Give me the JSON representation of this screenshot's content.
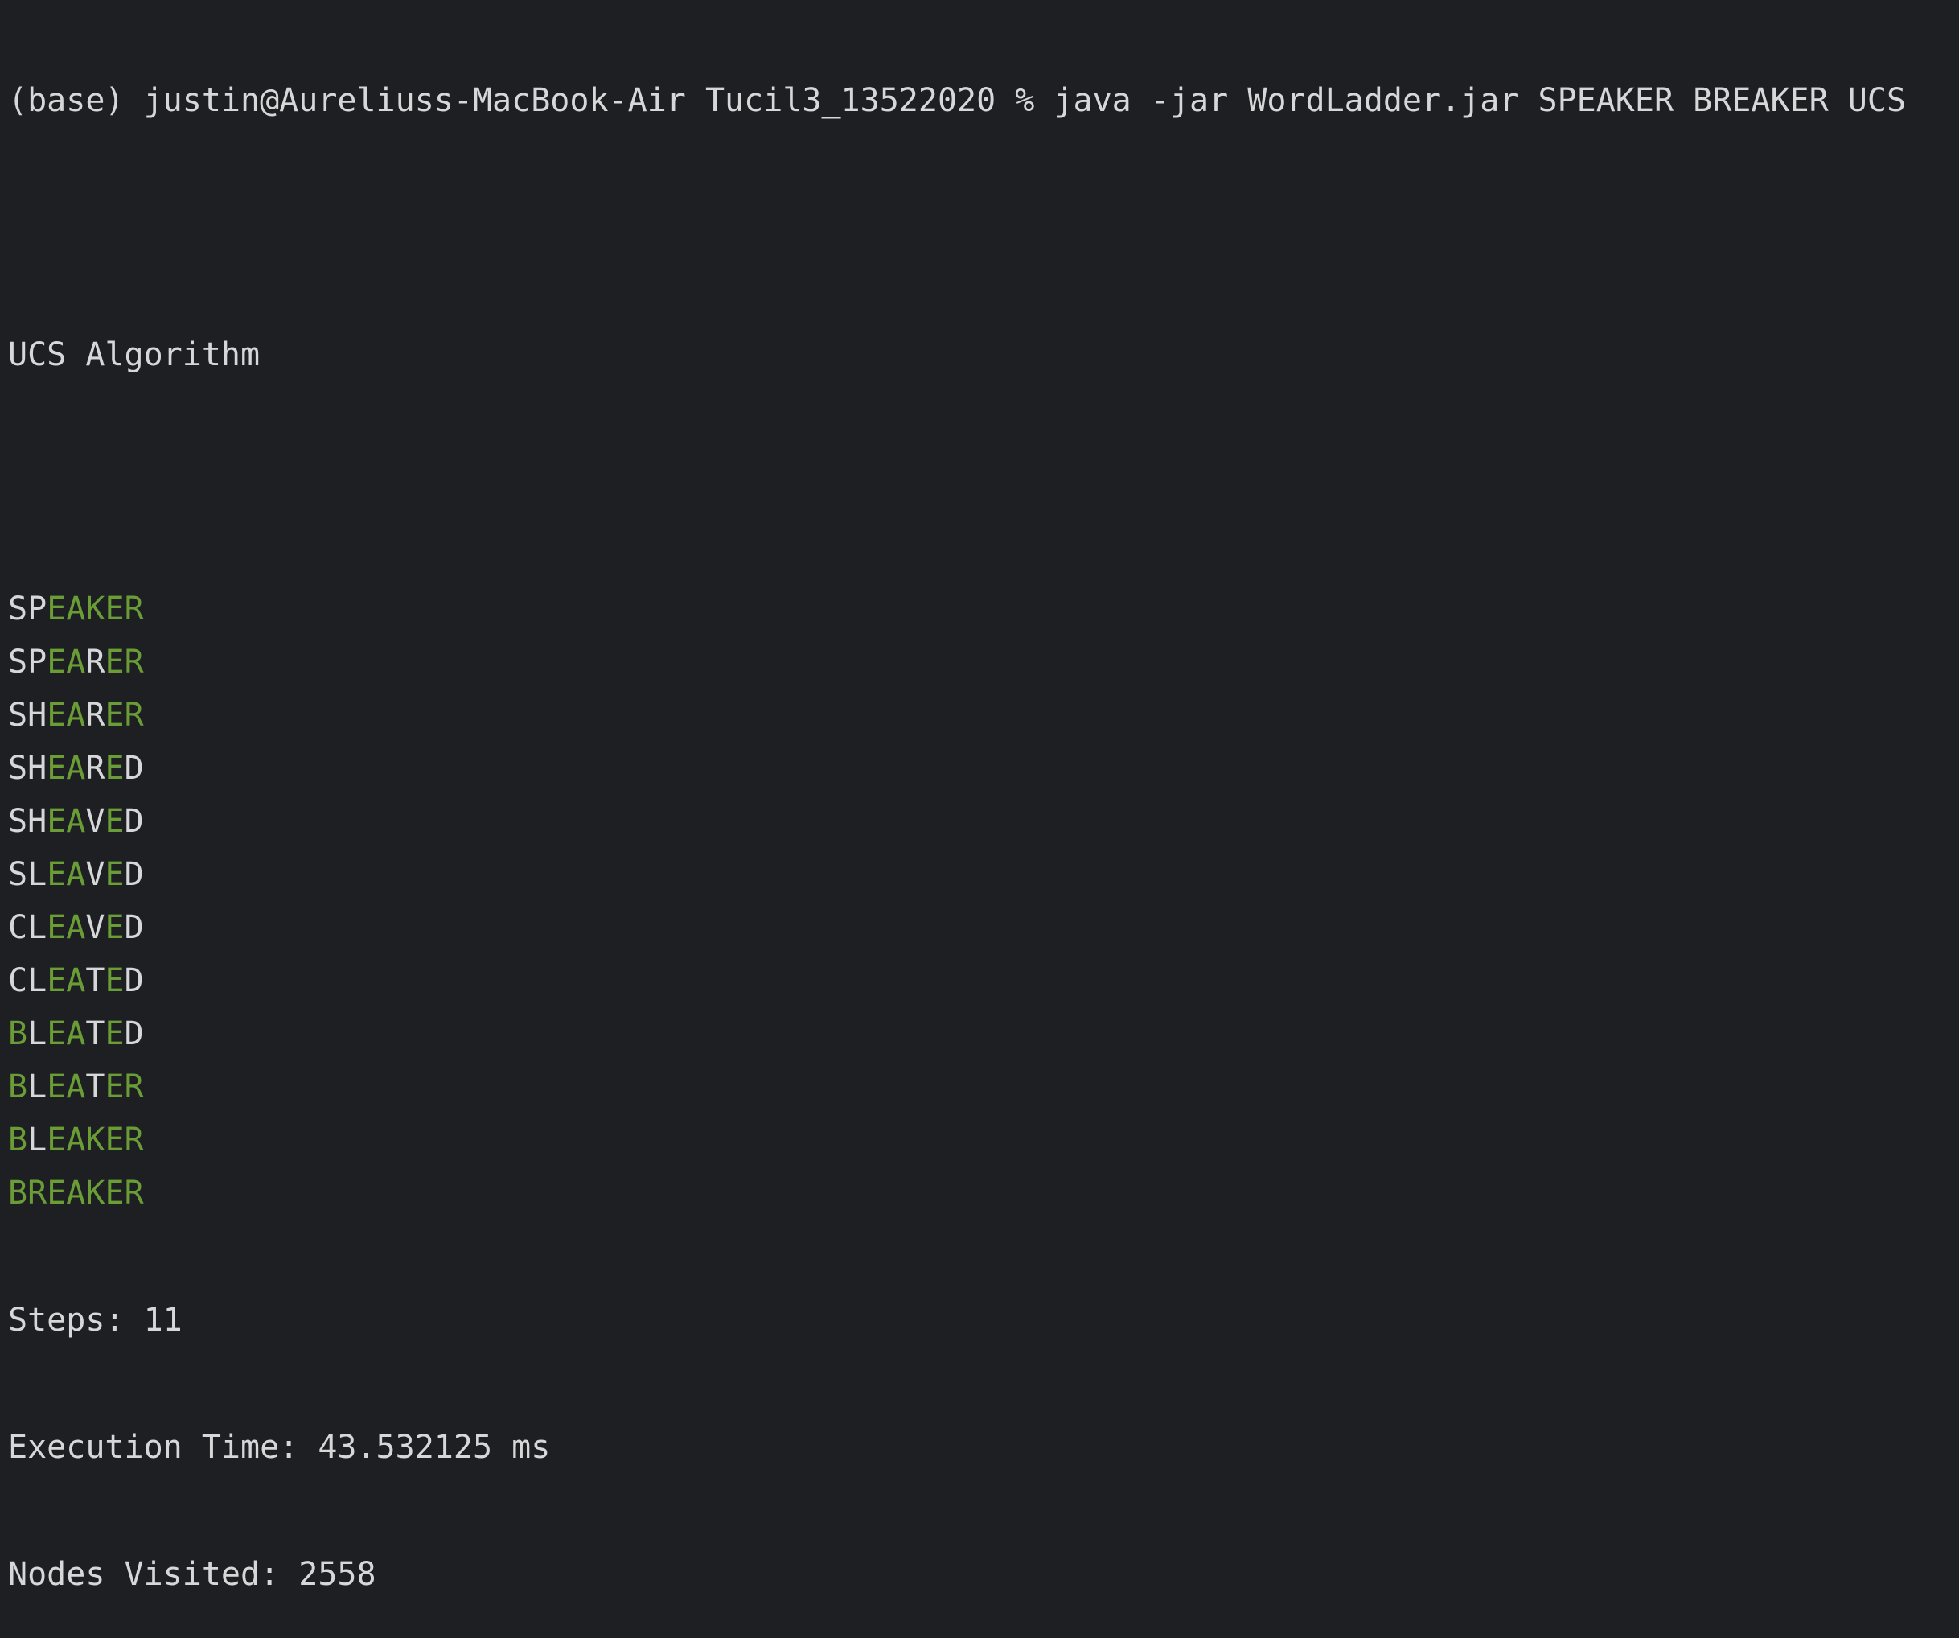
{
  "terminal": {
    "prompt_line": "(base) justin@Aureliuss-MacBook-Air Tucil3_13522020 % java -jar WordLadder.jar SPEAKER BREAKER UCS",
    "algorithm_heading": "UCS Algorithm",
    "target_word": "BREAKER",
    "colors": {
      "background": "#1e1f22",
      "text": "#d6d7d9",
      "match_highlight": "#6a9d36"
    },
    "ladder": [
      "SPEAKER",
      "SPEARER",
      "SHEARER",
      "SHEARED",
      "SHEAVED",
      "SLEAVED",
      "CLEAVED",
      "CLEATED",
      "BLEATED",
      "BLEATER",
      "BLEAKER",
      "BREAKER"
    ],
    "stats": {
      "steps": "Steps: 11",
      "execution_time": "Execution Time: 43.532125 ms",
      "nodes_visited": "Nodes Visited: 2558"
    }
  }
}
